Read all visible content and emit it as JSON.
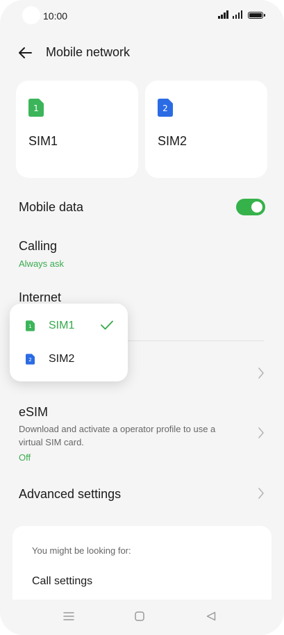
{
  "status_bar": {
    "time": "10:00"
  },
  "header": {
    "title": "Mobile network"
  },
  "sim_cards": [
    {
      "label": "SIM1",
      "number": "1",
      "color": "#3cb55a"
    },
    {
      "label": "SIM2",
      "number": "2",
      "color": "#2b6be4"
    }
  ],
  "mobile_data": {
    "label": "Mobile data",
    "enabled": true,
    "toggle_color": "#36b24a"
  },
  "calling": {
    "label": "Calling",
    "value": "Always ask"
  },
  "internet": {
    "label": "Internet"
  },
  "popup": {
    "items": [
      {
        "number": "1",
        "label": "SIM1",
        "selected": true
      },
      {
        "number": "2",
        "label": "SIM2",
        "selected": false
      }
    ]
  },
  "esim": {
    "label": "eSIM",
    "description": "Download and activate a operator profile to use a virtual SIM card.",
    "status": "Off"
  },
  "advanced": {
    "label": "Advanced settings"
  },
  "suggestions": {
    "title": "You might be looking for:",
    "items": [
      "Call settings"
    ]
  },
  "nav": {
    "icons": [
      "menu-icon",
      "home-icon",
      "back-triangle-icon"
    ]
  }
}
